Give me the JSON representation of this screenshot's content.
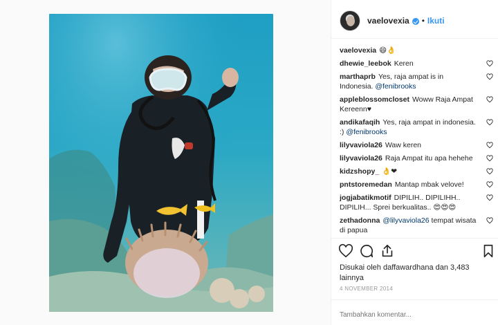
{
  "post": {
    "username": "vaelovexia",
    "follow_label": "Ikuti",
    "dot": "•"
  },
  "comments": [
    {
      "user": "vaelovexia",
      "text": "😄👌"
    },
    {
      "user": "dhewie_leebok",
      "text": "Keren"
    },
    {
      "user": "marthaprb",
      "text": "Yes, raja ampat is in Indonesia.",
      "mention": "@fenibrooks"
    },
    {
      "user": "appleblossomcloset",
      "text": "Woww Raja Ampat Kereenn♥"
    },
    {
      "user": "andikafaqih",
      "text": "Yes, raja ampat in indonesia. :)",
      "mention": "@fenibrooks"
    },
    {
      "user": "lilyvaviola26",
      "text": "Waw keren"
    },
    {
      "user": "lilyvaviola26",
      "text": "Raja Ampat itu apa hehehe"
    },
    {
      "user": "kidzshopy_",
      "text": "👌❤"
    },
    {
      "user": "pntstoremedan",
      "text": "Mantap mbak velove!"
    },
    {
      "user": "jogjabatikmotif",
      "text": "DIPILIH.. DIPILIHH.. DIPILIH... Sprei berkualitas.. 😍😍😍"
    },
    {
      "user": "zethadonna",
      "text": "tempat wisata di papua",
      "mention_first": "@lilyvaviola26"
    }
  ],
  "likes_text": "Disukai oleh daffawardhana dan 3,483 lainnya",
  "date": "4 NOVEMBER 2014",
  "add_comment_placeholder": "Tambahkan komentar...",
  "colors": {
    "accent": "#3897f0",
    "mention": "#003569",
    "text": "#262626",
    "muted": "#999999"
  },
  "icons": [
    "heart-icon",
    "comment-icon",
    "share-icon",
    "bookmark-icon"
  ]
}
